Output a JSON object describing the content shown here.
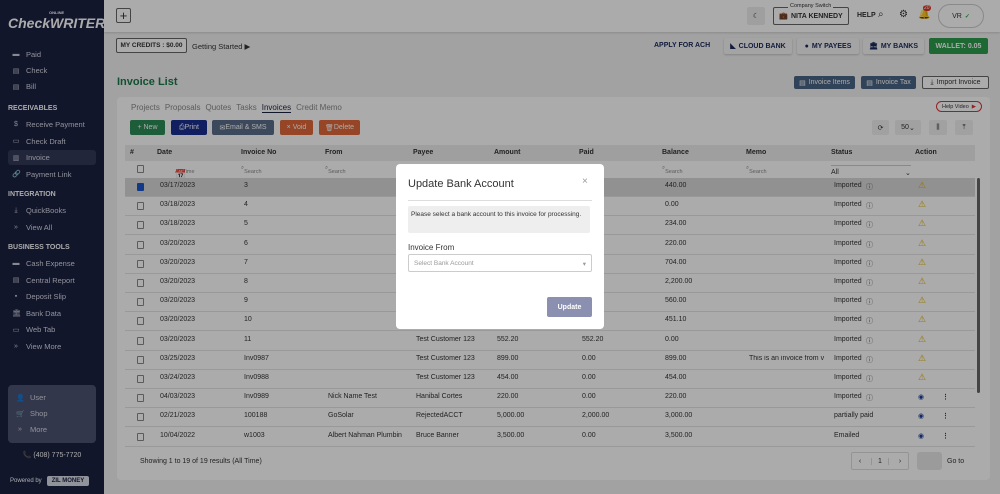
{
  "sidebar": {
    "logo": "CheckWRITER",
    "logo_small": "ONLINE",
    "items_top": [
      "Paid",
      "Check",
      "Bill"
    ],
    "receivables": {
      "title": "RECEIVABLES",
      "items": [
        "Receive Payment",
        "Check Draft",
        "Invoice",
        "Payment Link"
      ]
    },
    "integration": {
      "title": "INTEGRATION",
      "items": [
        "QuickBooks",
        "View All"
      ]
    },
    "business": {
      "title": "BUSINESS TOOLS",
      "items": [
        "Cash Expense",
        "Central Report",
        "Deposit Slip",
        "Bank Data",
        "Web Tab",
        "View More"
      ]
    },
    "box": [
      "User",
      "Shop",
      "More"
    ],
    "phone": "(408) 775-7720",
    "powered": "Powered by",
    "zil": "ZIL MONEY"
  },
  "topbar": {
    "company_switch": "Company Switch",
    "company": "NITA KENNEDY",
    "help": "HELP",
    "notif_count": "20",
    "avatar": "VR"
  },
  "subbar": {
    "credits": "MY CREDITS : $0.00",
    "getting_started": "Getting Started",
    "apply_ach": "APPLY FOR ACH",
    "cloud_bank": "CLOUD BANK",
    "my_payees": "MY PAYEES",
    "my_banks": "MY BANKS",
    "wallet": "WALLET: 0.05"
  },
  "page": {
    "title": "Invoice List",
    "invoice_items": "Invoice Items",
    "invoice_tax": "Invoice Tax",
    "import_invoice": "Import Invoice"
  },
  "tabs": [
    "Projects",
    "Proposals",
    "Quotes",
    "Tasks",
    "Invoices",
    "Credit Memo"
  ],
  "help_video": "Help Video",
  "actions": {
    "new": "+ New",
    "print": "Print",
    "email": "Email & SMS",
    "void": "× Void",
    "delete": "Delete",
    "page_size": "50"
  },
  "colors": {
    "new": "#2e8b57",
    "print": "#1a2f8f",
    "email": "#5a6e8a",
    "void": "#e0683a",
    "delete": "#e0683a",
    "wallet": "#2e9d4d",
    "title": "#1a7a4a"
  },
  "table": {
    "headers": [
      "#",
      "Date",
      "Invoice No",
      "From",
      "Payee",
      "Amount",
      "Paid",
      "Balance",
      "Memo",
      "Status",
      "Action"
    ],
    "date_filter": "All Time",
    "search": "Search",
    "status_filter": "All",
    "rows": [
      [
        "03/17/2023",
        "3",
        "",
        "",
        "",
        "",
        "440.00",
        "",
        "Imported",
        "warn",
        true
      ],
      [
        "03/18/2023",
        "4",
        "",
        "",
        "",
        "",
        "0.00",
        "",
        "Imported",
        "warn",
        false
      ],
      [
        "03/18/2023",
        "5",
        "",
        "",
        "",
        "",
        "234.00",
        "",
        "Imported",
        "warn",
        false
      ],
      [
        "03/20/2023",
        "6",
        "",
        "",
        "",
        "",
        "220.00",
        "",
        "Imported",
        "warn",
        false
      ],
      [
        "03/20/2023",
        "7",
        "",
        "",
        "",
        "",
        "704.00",
        "",
        "Imported",
        "warn",
        false
      ],
      [
        "03/20/2023",
        "8",
        "",
        "",
        "",
        "",
        "2,200.00",
        "",
        "Imported",
        "warn",
        false
      ],
      [
        "03/20/2023",
        "9",
        "",
        "",
        "",
        "",
        "560.00",
        "",
        "Imported",
        "warn",
        false
      ],
      [
        "03/20/2023",
        "10",
        "",
        "",
        "",
        "",
        "451.10",
        "",
        "Imported",
        "warn",
        false
      ],
      [
        "03/20/2023",
        "11",
        "",
        "Test Customer 123",
        "552.20",
        "552.20",
        "0.00",
        "",
        "Imported",
        "warn",
        false
      ],
      [
        "03/25/2023",
        "Inv0987",
        "",
        "Test Customer 123",
        "899.00",
        "0.00",
        "899.00",
        "This is an invoice from v",
        "Imported",
        "warn",
        false
      ],
      [
        "03/24/2023",
        "Inv0988",
        "",
        "Test Customer 123",
        "454.00",
        "0.00",
        "454.00",
        "",
        "Imported",
        "warn",
        false
      ],
      [
        "04/03/2023",
        "Inv0989",
        "Nick Name Test",
        "Hanibal Cortes",
        "220.00",
        "0.00",
        "220.00",
        "",
        "Imported",
        "eye",
        false
      ],
      [
        "02/21/2023",
        "100188",
        "GoSolar",
        "RejectedACCT",
        "5,000.00",
        "2,000.00",
        "3,000.00",
        "",
        "partially paid",
        "eye",
        false
      ],
      [
        "10/04/2022",
        "w1003",
        "Albert Nahman Plumbin",
        "Bruce Banner",
        "3,500.00",
        "0.00",
        "3,500.00",
        "",
        "Emailed",
        "eye",
        false
      ]
    ]
  },
  "footer": {
    "showing": "Showing 1 to 19 of 19 results (All Time)",
    "page": "1",
    "goto": "Go to"
  },
  "modal": {
    "title": "Update Bank Account",
    "message": "Please select a bank account to this invoice for processing.",
    "label": "Invoice From",
    "placeholder": "Select Bank Account",
    "update": "Update"
  }
}
